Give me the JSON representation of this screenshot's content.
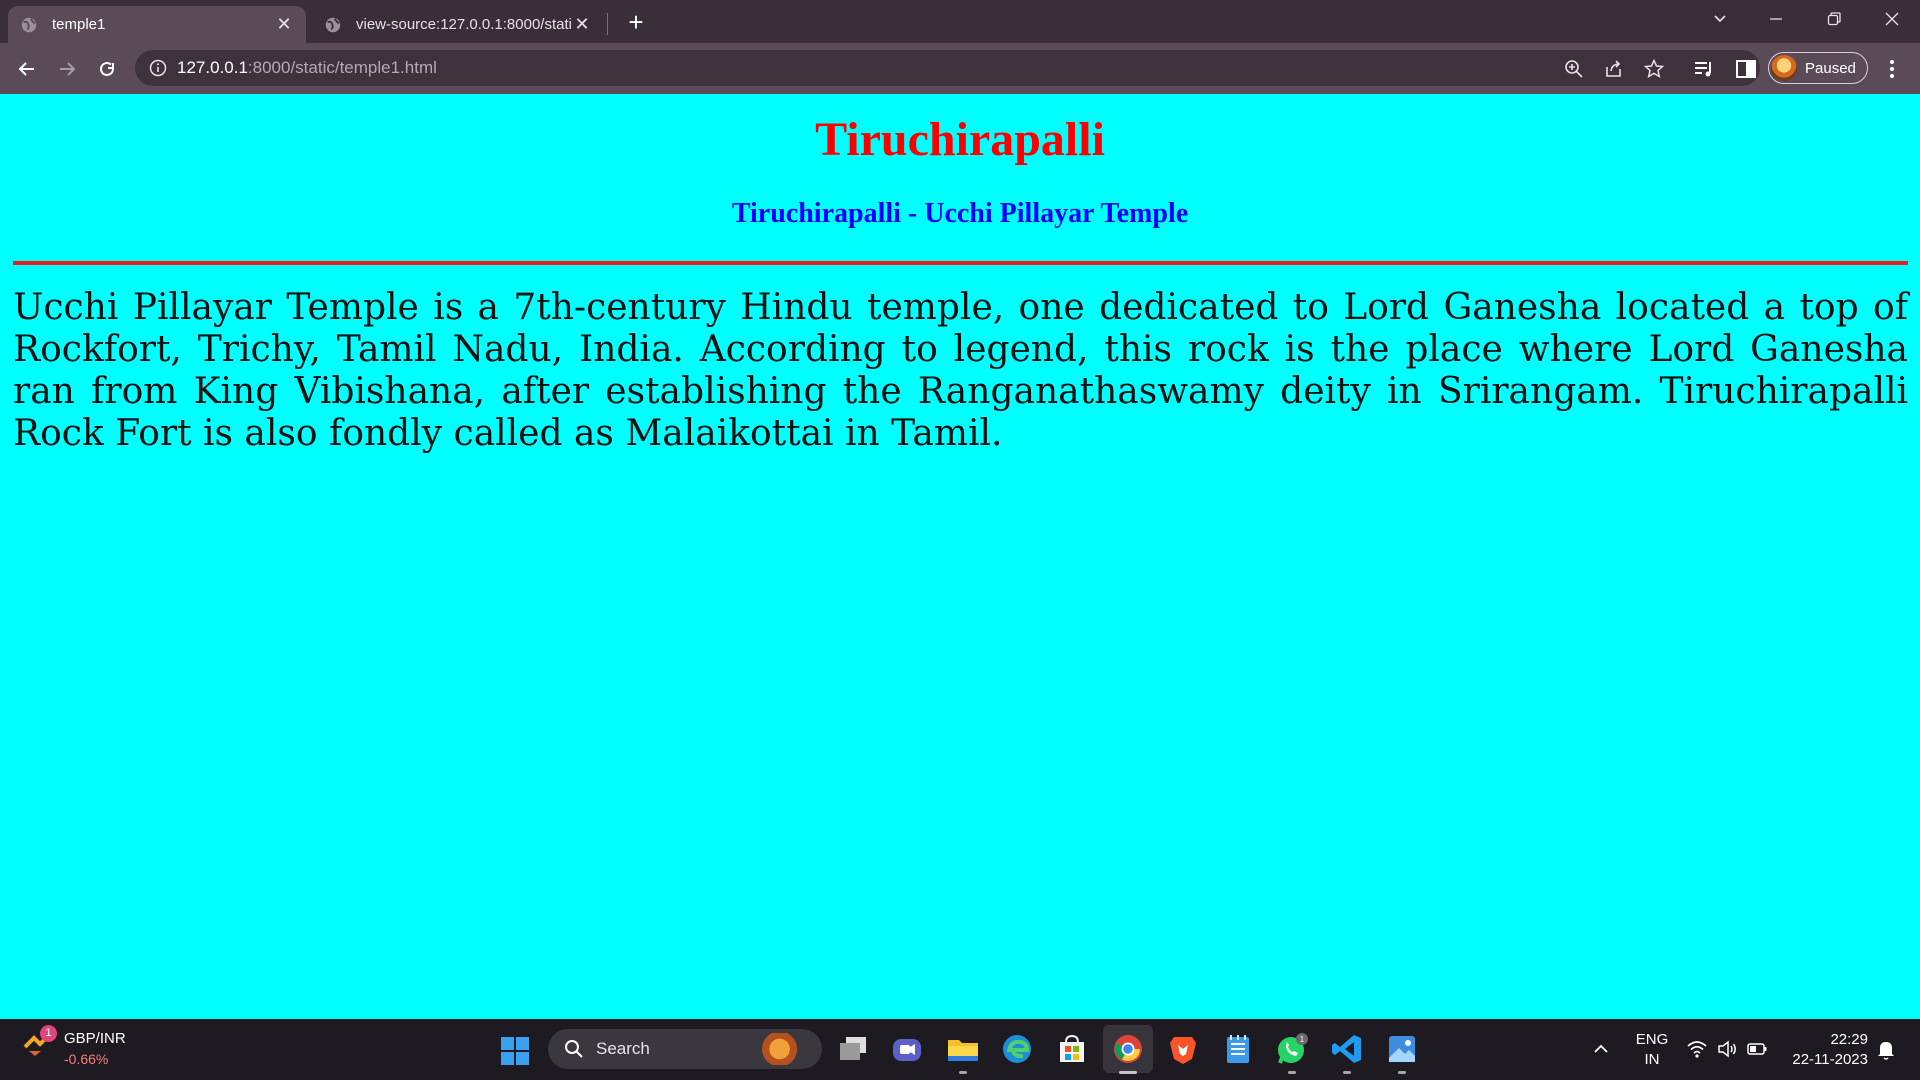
{
  "browser": {
    "tabs": [
      {
        "title": "temple1",
        "active": true
      },
      {
        "title": "view-source:127.0.0.1:8000/stati",
        "active": false
      }
    ],
    "address": {
      "host": "127.0.0.1",
      "rest": ":8000/static/temple1.html"
    },
    "profile_status": "Paused"
  },
  "page": {
    "heading": "Tiruchirapalli",
    "subheading": "Tiruchirapalli - Ucchi Pillayar Temple",
    "paragraph": "Ucchi Pillayar Temple is a 7th-century Hindu temple, one dedicated to Lord Ganesha located a top of Rockfort, Trichy, Tamil Nadu, India. According to legend, this rock is the place where Lord Ganesha ran from King Vibishana, after establishing the Ranganathaswamy deity in Srirangam. Tiruchirapalli Rock Fort is also fondly called as Malaikottai in Tamil.",
    "colors": {
      "background": "#00ffff",
      "heading": "#ff0000",
      "subheading": "#0000ff",
      "rule": "#ee1c1c"
    }
  },
  "taskbar": {
    "widget": {
      "badge": "1",
      "title": "GBP/INR",
      "value": "-0.66%"
    },
    "search_label": "Search",
    "whatsapp_badge": "1",
    "language": {
      "line1": "ENG",
      "line2": "IN"
    },
    "clock": {
      "time": "22:29",
      "date": "22-11-2023"
    }
  }
}
